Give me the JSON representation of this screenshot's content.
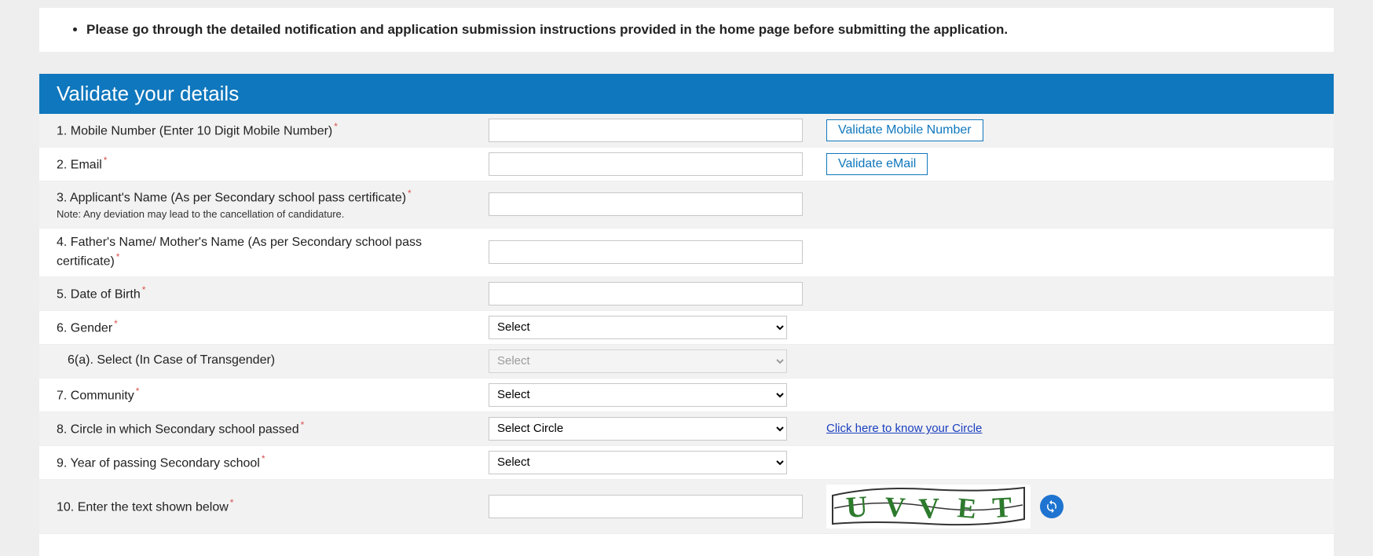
{
  "notice": {
    "items": [
      "Please go through the detailed notification and application submission instructions provided in the home page before submitting the application."
    ]
  },
  "section": {
    "title": "Validate your details"
  },
  "fields": {
    "mobile": {
      "label": "1. Mobile Number (Enter 10 Digit Mobile Number)",
      "value": "",
      "action_label": "Validate Mobile Number"
    },
    "email": {
      "label": "2. Email",
      "value": "",
      "action_label": "Validate eMail"
    },
    "name": {
      "label": "3. Applicant's Name (As per Secondary school pass certificate)",
      "note": "Note: Any deviation may lead to the cancellation of candidature.",
      "value": ""
    },
    "parent": {
      "label": "4. Father's Name/ Mother's Name (As per Secondary school pass certificate)",
      "value": ""
    },
    "dob": {
      "label": "5. Date of Birth",
      "value": ""
    },
    "gender": {
      "label": "6. Gender",
      "selected": "Select"
    },
    "gender_sub": {
      "label": "6(a). Select (In Case of Transgender)",
      "selected": "Select"
    },
    "community": {
      "label": "7. Community",
      "selected": "Select"
    },
    "circle": {
      "label": "8. Circle in which Secondary school passed",
      "selected": "Select Circle",
      "link_label": "Click here to know your Circle"
    },
    "year": {
      "label": "9. Year of passing Secondary school",
      "selected": "Select"
    },
    "captcha": {
      "label": "10. Enter the text shown below",
      "value": "",
      "text": "UVVET"
    }
  }
}
